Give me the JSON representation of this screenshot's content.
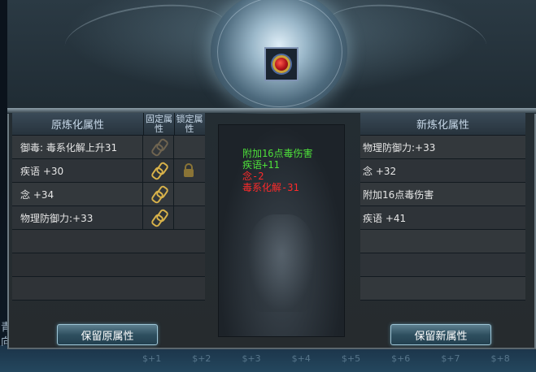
{
  "left_table": {
    "header": "原炼化属性",
    "fixed_header": "固定属性",
    "lock_header": "锁定属性",
    "rows": [
      {
        "label": "御毒: 毒系化解上升31",
        "chain": "dim",
        "lock": false
      },
      {
        "label": "疾语 +30",
        "chain": "gold",
        "lock": true
      },
      {
        "label": "念 +34",
        "chain": "gold",
        "lock": false
      },
      {
        "label": "物理防御力:+33",
        "chain": "gold",
        "lock": false
      }
    ]
  },
  "diff": {
    "lines": [
      {
        "text": "附加16点毒伤害",
        "color": "green"
      },
      {
        "text": "疾语+11",
        "color": "green"
      },
      {
        "text": "念-2",
        "color": "red"
      },
      {
        "text": "毒系化解-31",
        "color": "red"
      }
    ]
  },
  "right_table": {
    "header": "新炼化属性",
    "rows": [
      "物理防御力:+33",
      "念 +32",
      "附加16点毒伤害",
      "疾语 +41"
    ]
  },
  "buttons": {
    "keep_old": "保留原属性",
    "keep_new": "保留新属性"
  },
  "bottom_strip": [
    "$+1",
    "$+2",
    "$+3",
    "$+4",
    "$+5",
    "$+6",
    "$+7",
    "$+8"
  ],
  "left_edge": {
    "line1": "青",
    "line2": "向"
  }
}
